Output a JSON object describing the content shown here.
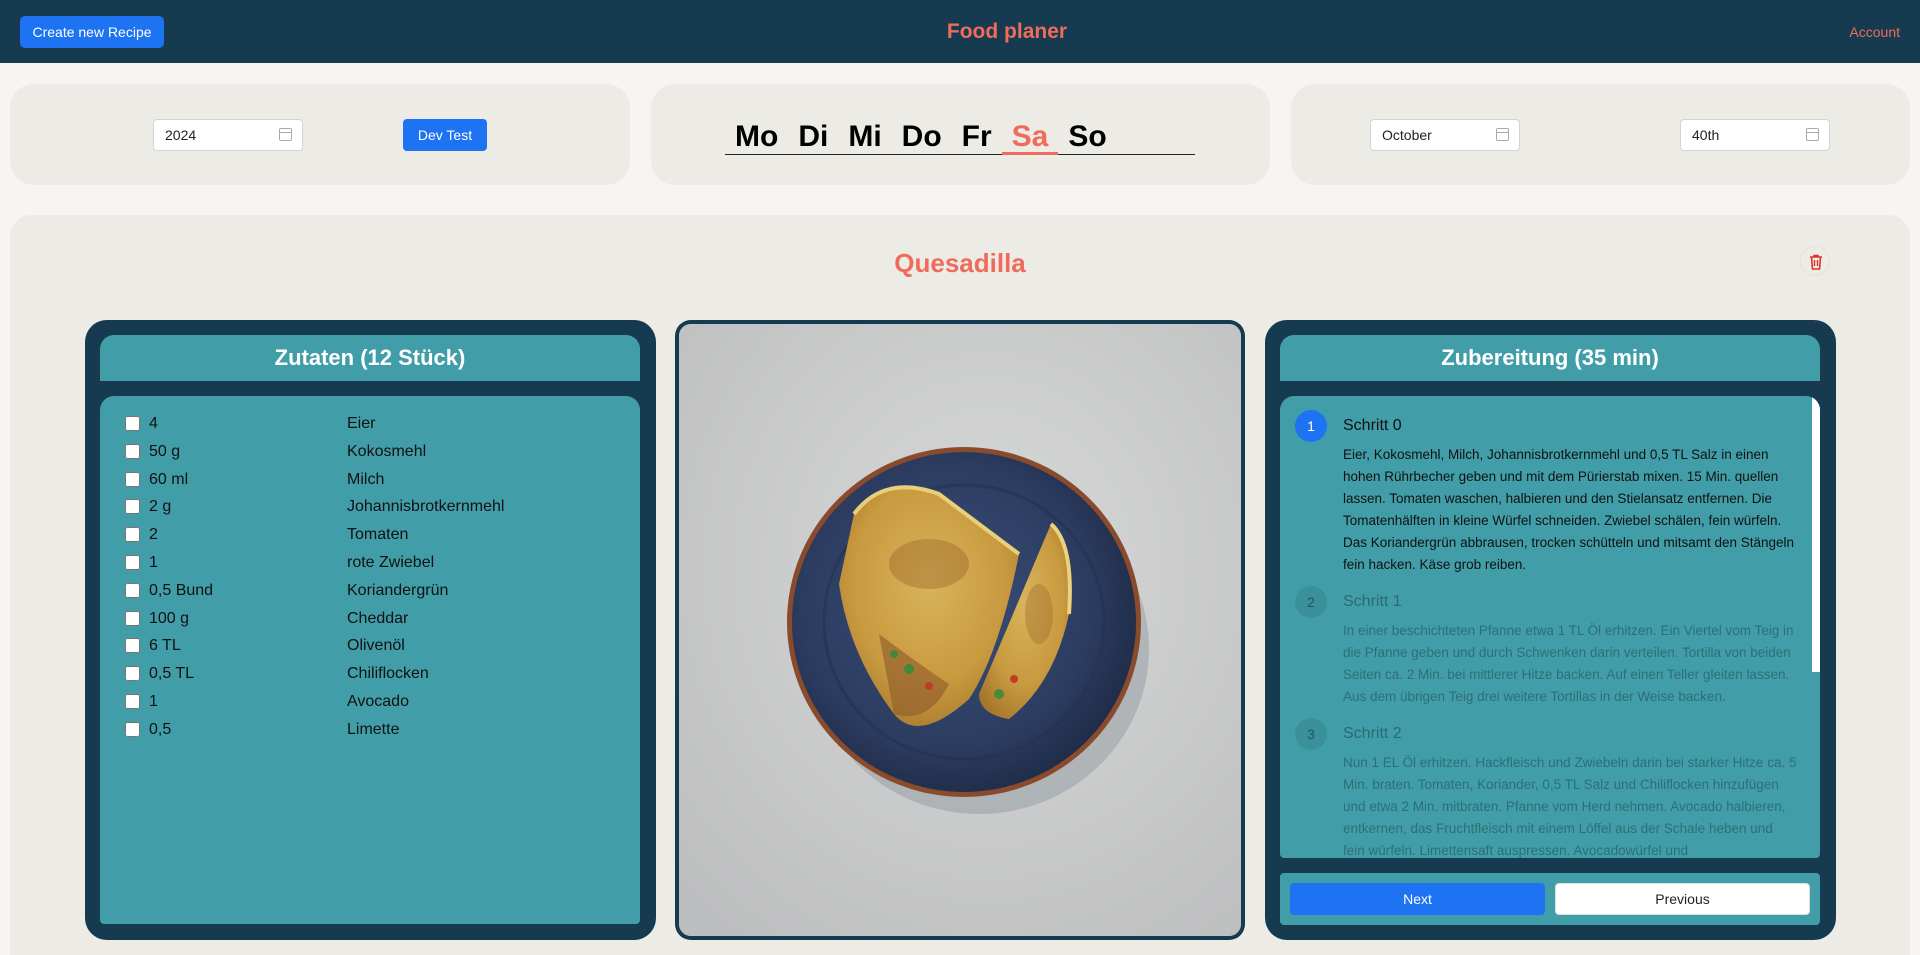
{
  "header": {
    "create_button": "Create new Recipe",
    "title": "Food planer",
    "account": "Account"
  },
  "controls": {
    "year_value": "2024",
    "dev_button": "Dev Test",
    "days": [
      "Mo",
      "Di",
      "Mi",
      "Do",
      "Fr",
      "Sa",
      "So"
    ],
    "selected_day": "Sa",
    "month_value": "October",
    "week_value": "40th"
  },
  "recipe": {
    "title": "Quesadilla",
    "ingredients_heading": "Zutaten (12 Stück)",
    "ingredients": [
      {
        "qty": "4",
        "name": "Eier"
      },
      {
        "qty": "50 g",
        "name": "Kokosmehl"
      },
      {
        "qty": "60 ml",
        "name": "Milch"
      },
      {
        "qty": "2 g",
        "name": "Johannisbrotkernmehl"
      },
      {
        "qty": "2",
        "name": "Tomaten"
      },
      {
        "qty": "1",
        "name": "rote Zwiebel"
      },
      {
        "qty": "0,5 Bund",
        "name": "Koriandergrün"
      },
      {
        "qty": "100 g",
        "name": "Cheddar"
      },
      {
        "qty": "6 TL",
        "name": "Olivenöl"
      },
      {
        "qty": "0,5 TL",
        "name": "Chiliflocken"
      },
      {
        "qty": "1",
        "name": "Avocado"
      },
      {
        "qty": "0,5",
        "name": "Limette"
      }
    ],
    "steps_heading": "Zubereitung (35 min)",
    "steps": [
      {
        "num": "1",
        "title": "Schritt 0",
        "text": "Eier, Kokosmehl, Milch, Johannisbrotkernmehl und 0,5 TL Salz in einen hohen Rührbecher geben und mit dem Pürierstab mixen. 15 Min. quellen lassen. Tomaten waschen, halbieren und den Stielansatz entfernen. Die Tomatenhälften in kleine Würfel schneiden. Zwiebel schälen, fein würfeln. Das Koriandergrün abbrausen, trocken schütteln und mitsamt den Stängeln fein hacken. Käse grob reiben."
      },
      {
        "num": "2",
        "title": "Schritt 1",
        "text": "In einer beschichteten Pfanne etwa 1 TL Öl erhitzen. Ein Viertel vom Teig in die Pfanne geben und durch Schwenken darin verteilen. Tortilla von beiden Seiten ca. 2 Min. bei mittlerer Hitze backen. Auf einen Teller gleiten lassen. Aus dem übrigen Teig drei weitere Tortillas in der Weise backen."
      },
      {
        "num": "3",
        "title": "Schritt 2",
        "text": "Nun 1 EL Öl erhitzen. Hackfleisch und Zwiebeln darin bei starker Hitze ca. 5 Min. braten. Tomaten, Koriander, 0,5 TL Salz und Chiliflocken hinzufügen und etwa 2 Min. mitbraten. Pfanne vom Herd nehmen. Avocado halbieren, entkernen, das Fruchtfleisch mit einem Löffel aus der Schale heben und fein würfeln. Limettensaft auspressen. Avocadowürfel und"
      }
    ],
    "next_button": "Next",
    "previous_button": "Previous"
  },
  "colors": {
    "navy": "#163a50",
    "teal": "#419ea8",
    "accent": "#f06c5a",
    "blue": "#1d73f2"
  },
  "icons": [
    "calendar-icon",
    "trash-icon"
  ]
}
